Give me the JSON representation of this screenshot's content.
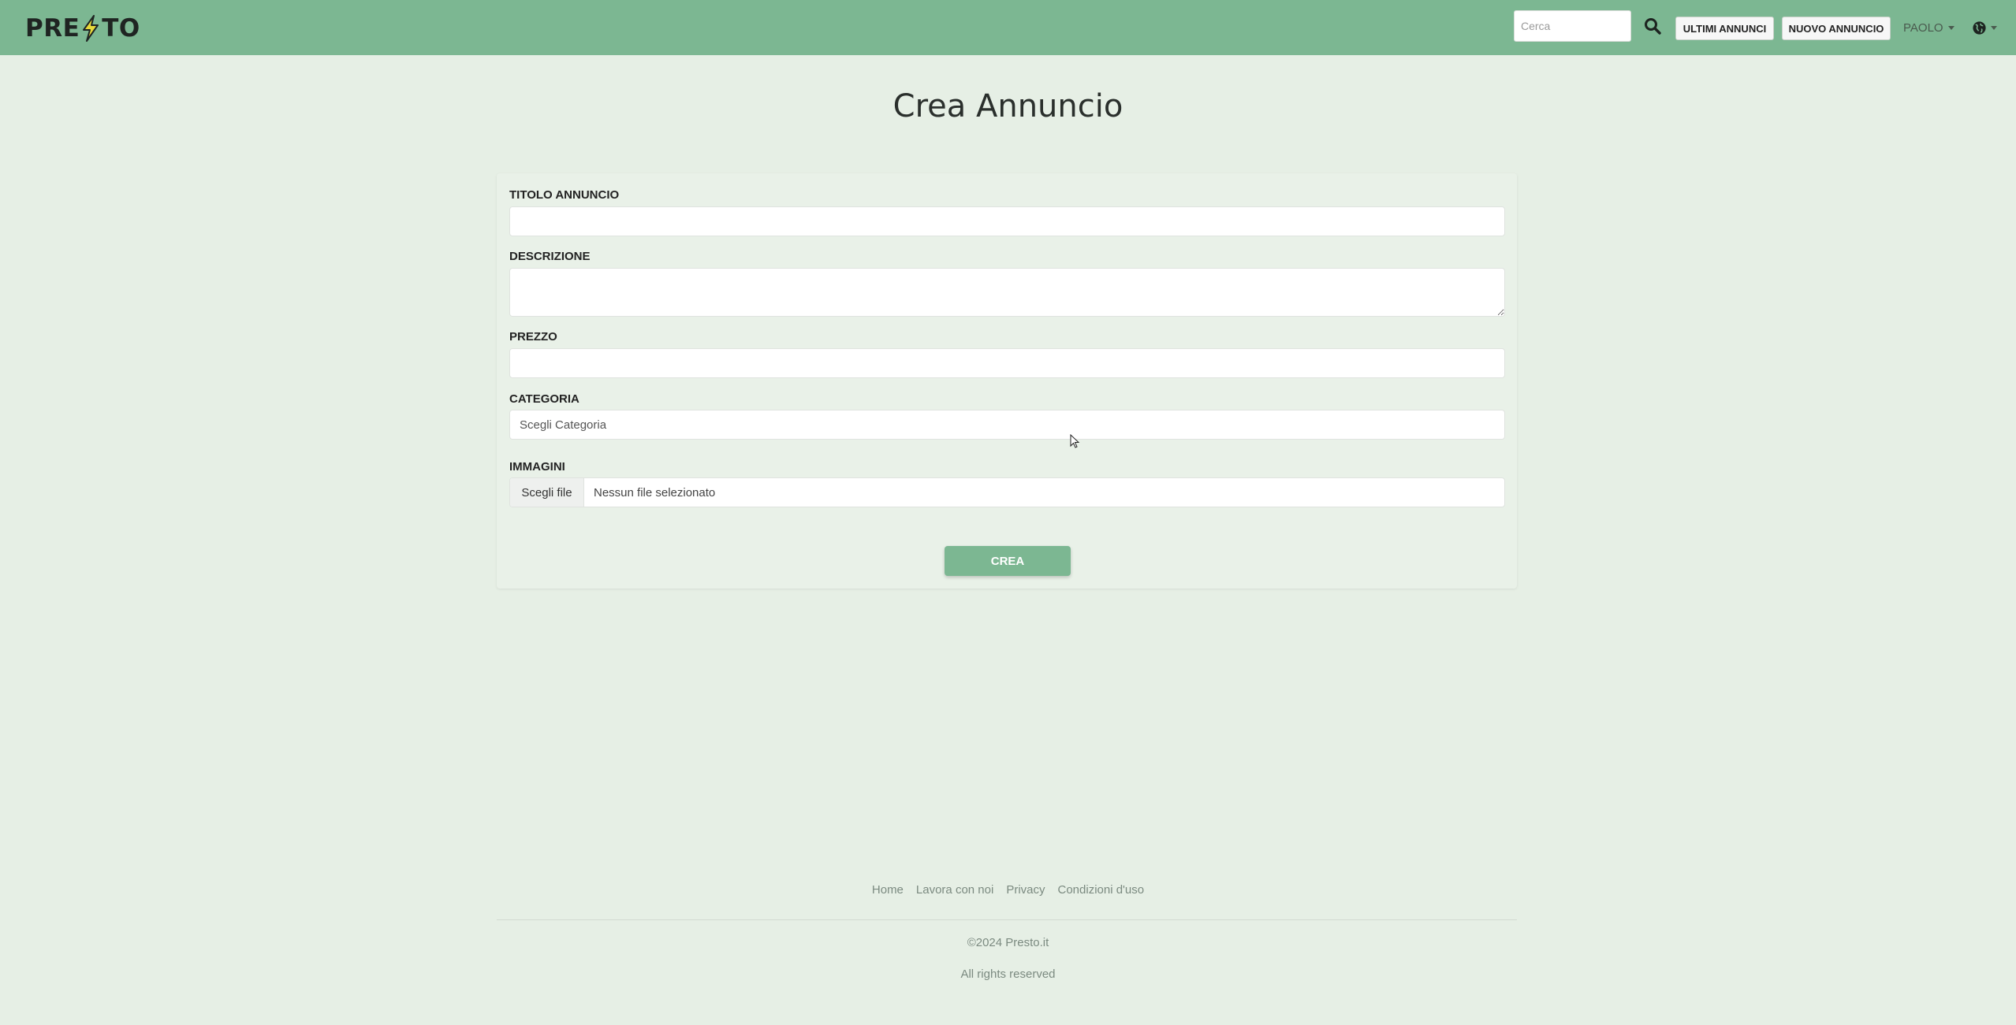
{
  "navbar": {
    "logo_text_left": "PRE",
    "logo_text_right": "TO",
    "search_placeholder": "Cerca",
    "ultimi_label": "ULTIMI ANNUNCI",
    "nuovo_label": "NUOVO ANNUNCIO",
    "user_name": "PAOLO",
    "search_icon": "search-icon",
    "language_icon": "globe-icon",
    "brand_color": "#7cb792"
  },
  "page": {
    "title": "Crea Annuncio"
  },
  "form": {
    "title_label": "TITOLO ANNUNCIO",
    "title_value": "",
    "description_label": "DESCRIZIONE",
    "description_value": "",
    "price_label": "PREZZO",
    "price_value": "",
    "category_label": "CATEGORIA",
    "category_selected": "Scegli Categoria",
    "images_label": "IMMAGINI",
    "file_button": "Scegli file",
    "file_status": "Nessun file selezionato",
    "submit_label": "CREA"
  },
  "footer": {
    "links": [
      "Home",
      "Lavora con noi",
      "Privacy",
      "Condizioni d'uso"
    ],
    "copyright": "©2024 Presto.it",
    "rights": "All rights reserved"
  }
}
